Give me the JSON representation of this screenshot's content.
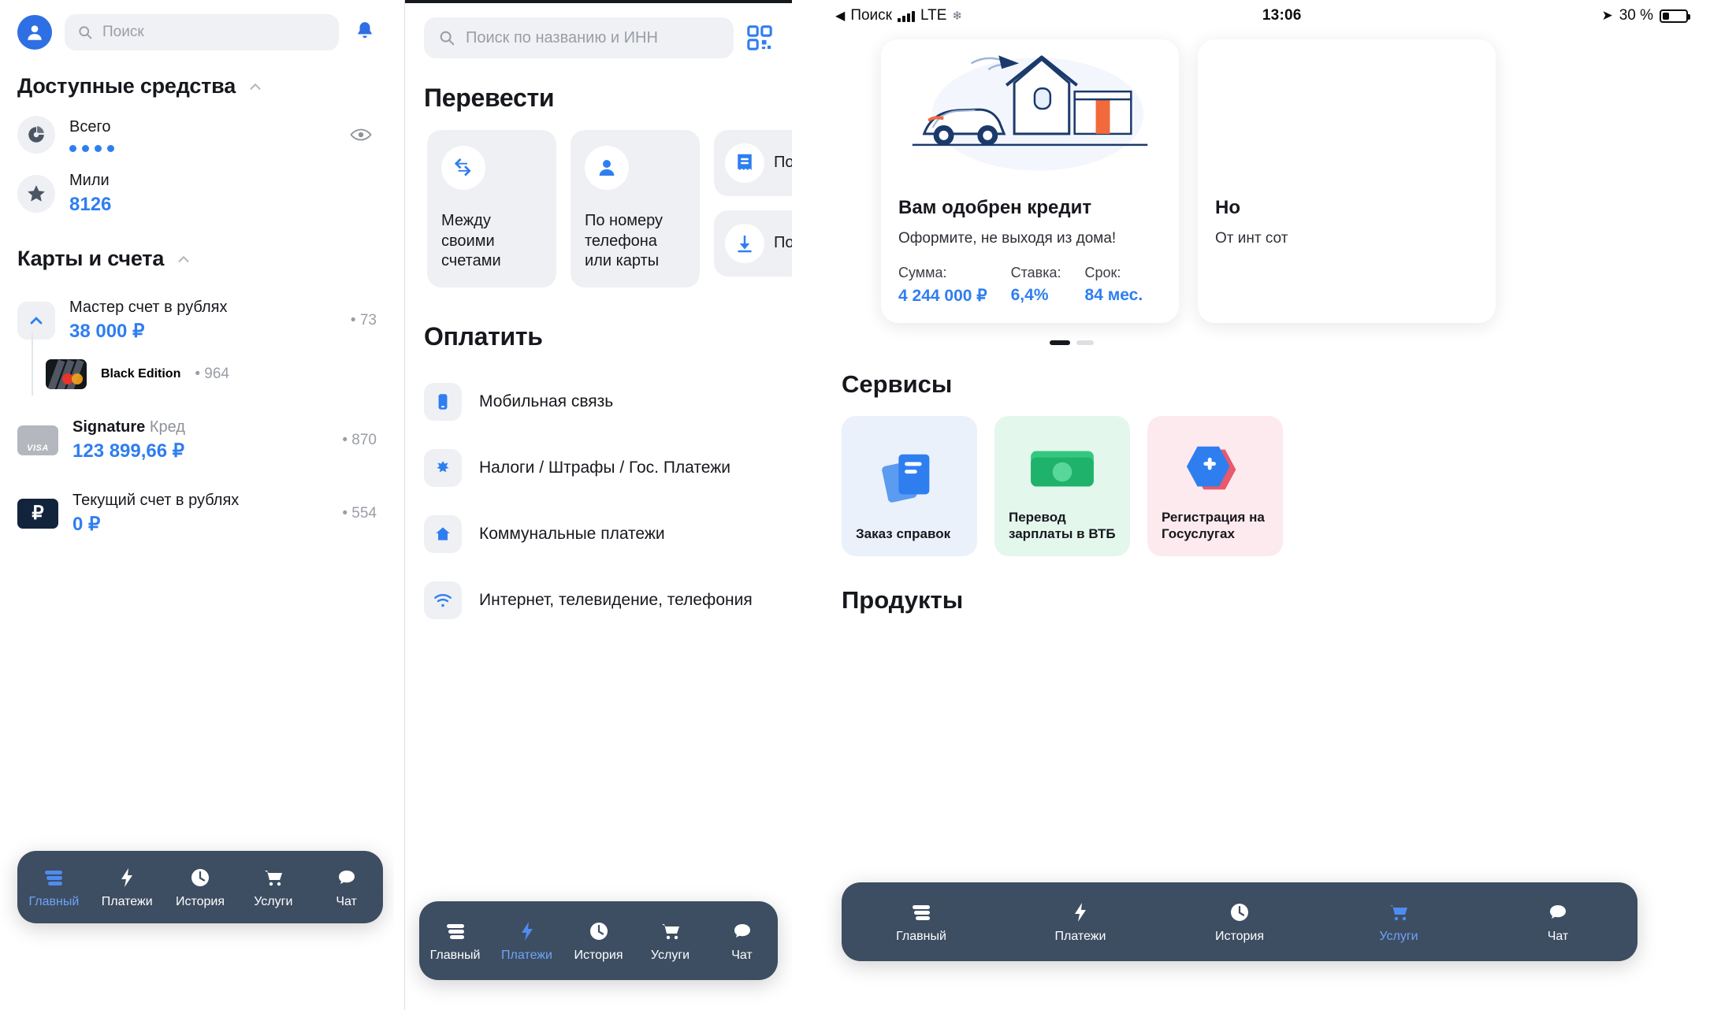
{
  "panel1": {
    "search": {
      "placeholder": "Поиск",
      "icon": "search-icon"
    },
    "avatar_icon": "user-avatar-icon",
    "bell_icon": "bell-icon",
    "sections": [
      {
        "title": "Доступные средства",
        "chevron": "chevron-up-icon"
      },
      {
        "title": "Карты и счета",
        "chevron": "chevron-up-icon"
      }
    ],
    "funds": [
      {
        "icon": "pie-chart-icon",
        "label": "Всего",
        "masked": true,
        "value": "",
        "trailing": "eye-icon"
      },
      {
        "icon": "star-icon",
        "label": "Мили",
        "value": "8126",
        "trailing": ""
      }
    ],
    "accounts": [
      {
        "icon": "chevron-up-square-icon",
        "label": "Мастер счет в рублях",
        "value": "38 000 ₽",
        "number": "• 73"
      },
      {
        "icon": "mastercard-black-icon",
        "label": "Black Edition",
        "value": "",
        "number": "• 964",
        "child": true
      },
      {
        "icon": "visa-grey-icon",
        "label": "Signature",
        "label_suffix": "Кред",
        "value": "123 899,66 ₽",
        "number": "• 870"
      },
      {
        "icon": "ruble-account-icon",
        "label": "Текущий счет в рублях",
        "value": "0 ₽",
        "number": "• 554"
      }
    ],
    "tabs": [
      {
        "label": "Главный",
        "icon": "home-stack-icon",
        "active": true
      },
      {
        "label": "Платежи",
        "icon": "lightning-icon",
        "active": false
      },
      {
        "label": "История",
        "icon": "clock-icon",
        "active": false
      },
      {
        "label": "Услуги",
        "icon": "cart-icon",
        "active": false
      },
      {
        "label": "Чат",
        "icon": "chat-icon",
        "active": false
      }
    ]
  },
  "panel2": {
    "search": {
      "placeholder": "Поиск по названию и ИНН",
      "icon": "search-icon"
    },
    "qr_icon": "qr-code-icon",
    "transfer_heading": "Перевести",
    "transfer_tiles": [
      {
        "label": "Между своими счетами",
        "icon": "transfer-arrows-icon"
      },
      {
        "label": "По номеру телефона или карты",
        "icon": "person-icon"
      },
      {
        "label": "По",
        "icon": "receipt-icon"
      },
      {
        "label": "По",
        "icon": "download-icon"
      }
    ],
    "pay_heading": "Оплатить",
    "pay_items": [
      {
        "label": "Мобильная связь",
        "icon": "mobile-phone-icon"
      },
      {
        "label": "Налоги / Штрафы / Гос. Платежи",
        "icon": "eagle-emblem-icon"
      },
      {
        "label": "Коммунальные платежи",
        "icon": "home-icon"
      },
      {
        "label": "Интернет, телевидение, телефония",
        "icon": "wifi-icon"
      }
    ],
    "tabs": [
      {
        "label": "Главный",
        "icon": "home-stack-icon",
        "active": false
      },
      {
        "label": "Платежи",
        "icon": "lightning-icon",
        "active": true
      },
      {
        "label": "История",
        "icon": "clock-icon",
        "active": false
      },
      {
        "label": "Услуги",
        "icon": "cart-icon",
        "active": false
      },
      {
        "label": "Чат",
        "icon": "chat-icon",
        "active": false
      }
    ]
  },
  "panel3": {
    "status_bar": {
      "back_label": "Поиск",
      "carrier": "LTE",
      "snowflake": "❄",
      "time": "13:06",
      "location_icon": "location-arrow-icon",
      "battery_text": "30 %"
    },
    "offers": [
      {
        "title": "Вам одобрен кредит",
        "subtitle": "Оформите, не выходя из дома!",
        "params": [
          {
            "key": "Сумма:",
            "value": "4 244 000 ₽"
          },
          {
            "key": "Ставка:",
            "value": "6,4%"
          },
          {
            "key": "Срок:",
            "value": "84 мес."
          }
        ]
      },
      {
        "title": "Но",
        "subtitle": "От инт сот",
        "params": []
      }
    ],
    "carousel_dots": {
      "active_index": 0,
      "count": 2
    },
    "services_heading": "Сервисы",
    "services": [
      {
        "label": "Заказ справок",
        "icon": "documents-icon",
        "color": "blue"
      },
      {
        "label": "Перевод зарплаты в ВТБ",
        "icon": "money-icon",
        "color": "green"
      },
      {
        "label": "Регистрация на Госуслугах",
        "icon": "gosuslugi-icon",
        "color": "pink"
      }
    ],
    "products_heading": "Продукты",
    "tabs": [
      {
        "label": "Главный",
        "icon": "home-stack-icon",
        "active": false
      },
      {
        "label": "Платежи",
        "icon": "lightning-icon",
        "active": false
      },
      {
        "label": "История",
        "icon": "clock-icon",
        "active": false
      },
      {
        "label": "Услуги",
        "icon": "cart-icon",
        "active": true
      },
      {
        "label": "Чат",
        "icon": "chat-icon",
        "active": false
      }
    ]
  },
  "colors": {
    "accent_blue": "#2f7ef0",
    "tabbar_bg": "#3d4d62",
    "grey_surface": "#eef0f3"
  }
}
